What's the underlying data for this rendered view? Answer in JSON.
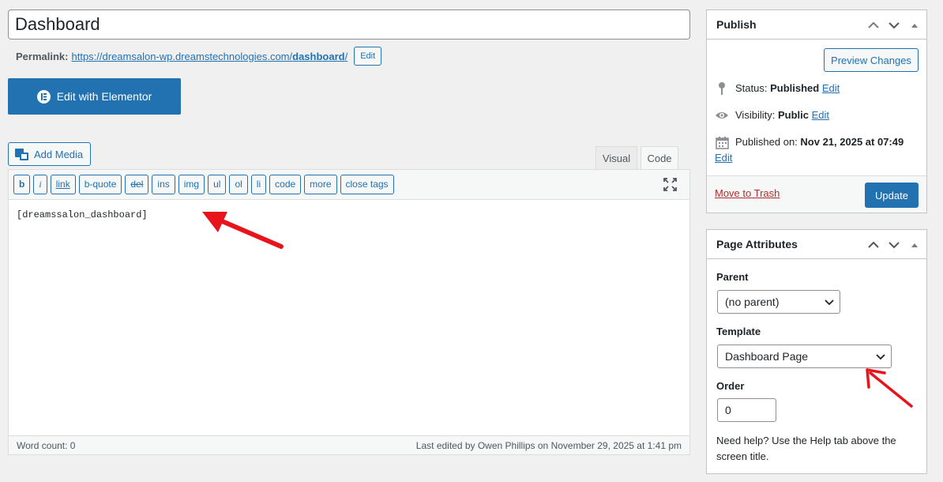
{
  "editor": {
    "title": "Dashboard",
    "permalink_label": "Permalink:",
    "permalink_base": "https://dreamsalon-wp.dreamstechnologies.com/",
    "permalink_slug": "dashboard",
    "permalink_trail": "/",
    "permalink_edit": "Edit",
    "elementor_label": "Edit with Elementor",
    "add_media_label": "Add Media",
    "tabs": {
      "visual": "Visual",
      "code": "Code"
    },
    "quicktags": [
      "b",
      "i",
      "link",
      "b-quote",
      "del",
      "ins",
      "img",
      "ul",
      "ol",
      "li",
      "code",
      "more",
      "close tags"
    ],
    "content": "[dreamssalon_dashboard]",
    "word_count": "Word count: 0",
    "last_edited": "Last edited by Owen Phillips on November 29, 2025 at 1:41 pm"
  },
  "publish": {
    "title": "Publish",
    "preview_label": "Preview Changes",
    "status_label": "Status:",
    "status_value": "Published",
    "visibility_label": "Visibility:",
    "visibility_value": "Public",
    "published_label": "Published on:",
    "published_value": "Nov 21, 2025 at 07:49",
    "edit_link": "Edit",
    "trash_label": "Move to Trash",
    "update_label": "Update"
  },
  "attributes": {
    "title": "Page Attributes",
    "parent_label": "Parent",
    "parent_value": "(no parent)",
    "template_label": "Template",
    "template_value": "Dashboard Page",
    "order_label": "Order",
    "order_value": "0",
    "help_text": "Need help? Use the Help tab above the screen title."
  },
  "colors": {
    "accent": "#2271b1",
    "annotation_arrow": "#e8141b",
    "trash": "#b32d2e"
  }
}
